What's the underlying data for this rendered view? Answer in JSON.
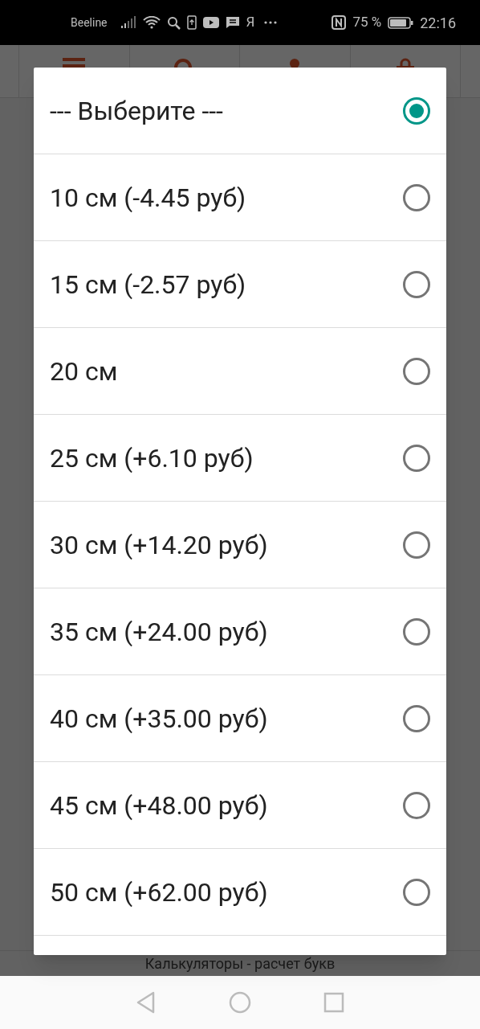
{
  "status_bar": {
    "carrier": "Beeline",
    "extra_glyph": "Я",
    "battery": "75 %",
    "time": "22:16"
  },
  "page": {
    "footer": "Калькуляторы - расчет букв"
  },
  "dialog": {
    "options": [
      {
        "label": "--- Выберите ---",
        "selected": true
      },
      {
        "label": "10 см (-4.45 руб)",
        "selected": false
      },
      {
        "label": "15 см (-2.57 руб)",
        "selected": false
      },
      {
        "label": "20 см",
        "selected": false
      },
      {
        "label": "25 см (+6.10 руб)",
        "selected": false
      },
      {
        "label": "30 см (+14.20 руб)",
        "selected": false
      },
      {
        "label": "35 см (+24.00 руб)",
        "selected": false
      },
      {
        "label": "40 см (+35.00 руб)",
        "selected": false
      },
      {
        "label": "45 см (+48.00 руб)",
        "selected": false
      },
      {
        "label": "50 см (+62.00 руб)",
        "selected": false
      }
    ]
  }
}
